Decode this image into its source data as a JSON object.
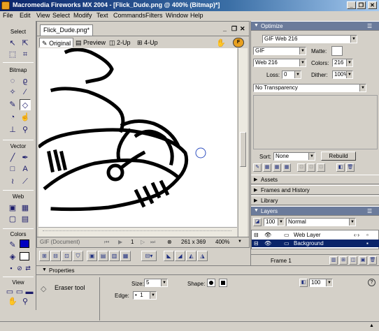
{
  "window": {
    "title": "Macromedia Fireworks MX 2004 - [Flick_Dude.png @ 400% (Bitmap)*]",
    "minimize": "_",
    "restore": "❐",
    "close": "✕"
  },
  "menu": [
    "File",
    "Edit",
    "View",
    "Select",
    "Modify",
    "Text",
    "Commands",
    "Filters",
    "Window",
    "Help"
  ],
  "tools": {
    "select_label": "Select",
    "bitmap_label": "Bitmap",
    "vector_label": "Vector",
    "web_label": "Web",
    "colors_label": "Colors",
    "view_label": "View"
  },
  "document": {
    "tab_title": "Flick_Dude.png*",
    "view_tabs": [
      "Original",
      "Preview",
      "2-Up",
      "4-Up"
    ],
    "status_format": "GIF (Document)",
    "page_number": "1",
    "dimensions": "261 x 369",
    "zoom": "400%"
  },
  "optimize": {
    "header": "Optimize",
    "settings": "GIF Web 216",
    "format": "GIF",
    "matte_label": "Matte:",
    "palette": "Web 216",
    "colors_label": "Colors:",
    "colors_value": "216",
    "loss_label": "Loss:",
    "loss_value": "0",
    "dither_label": "Dither:",
    "dither_value": "100%",
    "transparency": "No Transparency",
    "sort_label": "Sort:",
    "sort_value": "None",
    "rebuild": "Rebuild"
  },
  "panels": {
    "assets": "Assets",
    "frames_history": "Frames and History",
    "library": "Library",
    "layers": "Layers"
  },
  "layers": {
    "opacity": "100",
    "blend": "Normal",
    "rows": [
      {
        "name": "Web Layer",
        "selected": false
      },
      {
        "name": "Background",
        "selected": true
      }
    ],
    "frame_label": "Frame 1"
  },
  "properties": {
    "header": "Properties",
    "tool_name": "Eraser tool",
    "size_label": "Size:",
    "size_value": "5",
    "edge_label": "Edge:",
    "edge_value": "1",
    "shape_label": "Shape:",
    "opacity_value": "100"
  },
  "colors": {
    "title_start": "#0a246a",
    "title_end": "#a6caf0",
    "chrome": "#d4d0c8",
    "selection": "#0a246a"
  }
}
